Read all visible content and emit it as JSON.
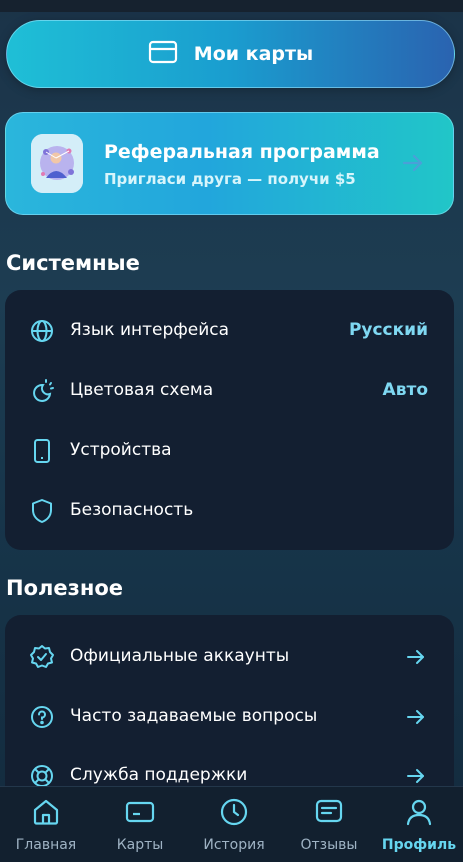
{
  "my_cards": {
    "label": "Мои карты",
    "icon": "credit-card-icon"
  },
  "referral": {
    "title": "Реферальная программа",
    "subtitle": "Пригласи друга — получи $5",
    "icon": "arrow-right-icon"
  },
  "system_section": {
    "title": "Системные",
    "items": [
      {
        "label": "Язык интерфейса",
        "value": "Русский",
        "icon": "globe-icon"
      },
      {
        "label": "Цветовая схема",
        "value": "Авто",
        "icon": "theme-icon"
      },
      {
        "label": "Устройства",
        "icon": "phone-icon"
      },
      {
        "label": "Безопасность",
        "icon": "shield-icon"
      }
    ]
  },
  "useful_section": {
    "title": "Полезное",
    "items": [
      {
        "label": "Официальные аккаунты",
        "icon": "verified-badge-icon"
      },
      {
        "label": "Часто задаваемые вопросы",
        "icon": "question-icon"
      },
      {
        "label": "Служба поддержки",
        "icon": "lifebuoy-icon"
      }
    ]
  },
  "nav": {
    "items": [
      {
        "label": "Главная",
        "icon": "home-icon"
      },
      {
        "label": "Карты",
        "icon": "card-icon"
      },
      {
        "label": "История",
        "icon": "clock-icon"
      },
      {
        "label": "Отзывы",
        "icon": "message-icon"
      },
      {
        "label": "Профиль",
        "icon": "user-icon",
        "active": true
      }
    ]
  },
  "colors": {
    "accent": "#66d6f0",
    "card_bg": "#131f31",
    "gradient_start": "#1fbfd6",
    "gradient_end": "#2a63b0"
  }
}
